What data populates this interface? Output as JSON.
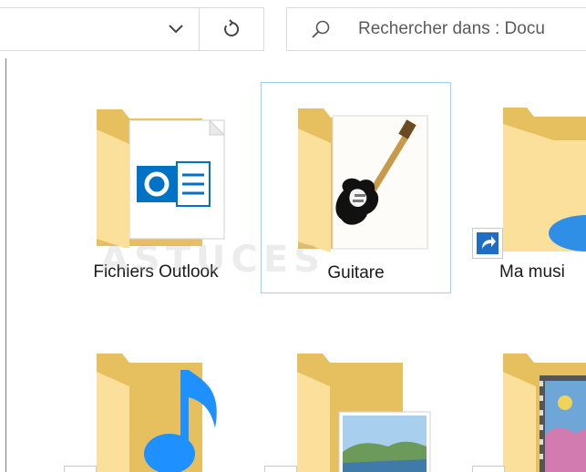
{
  "toolbar": {
    "dropdown_icon": "chevron-down-icon",
    "refresh_icon": "refresh-icon"
  },
  "search": {
    "icon": "search-icon",
    "placeholder": "Rechercher dans : Docu"
  },
  "items": [
    {
      "label": "Fichiers Outlook",
      "icon": "outlook-folder-icon",
      "selected": false
    },
    {
      "label": "Guitare",
      "icon": "guitar-folder-icon",
      "selected": true
    },
    {
      "label": "Ma musi",
      "icon": "music-shortcut-folder-icon",
      "selected": false
    },
    {
      "label": "",
      "icon": "music-note-folder-icon",
      "selected": false
    },
    {
      "label": "",
      "icon": "pictures-folder-icon",
      "selected": false
    },
    {
      "label": "",
      "icon": "videos-folder-icon",
      "selected": false
    }
  ],
  "watermark": "ASTUCES",
  "colors": {
    "folder_back": "#e8c05c",
    "folder_front": "#fbe19a",
    "selection_border": "#99d1ff",
    "outlook_blue": "#0072c6"
  }
}
